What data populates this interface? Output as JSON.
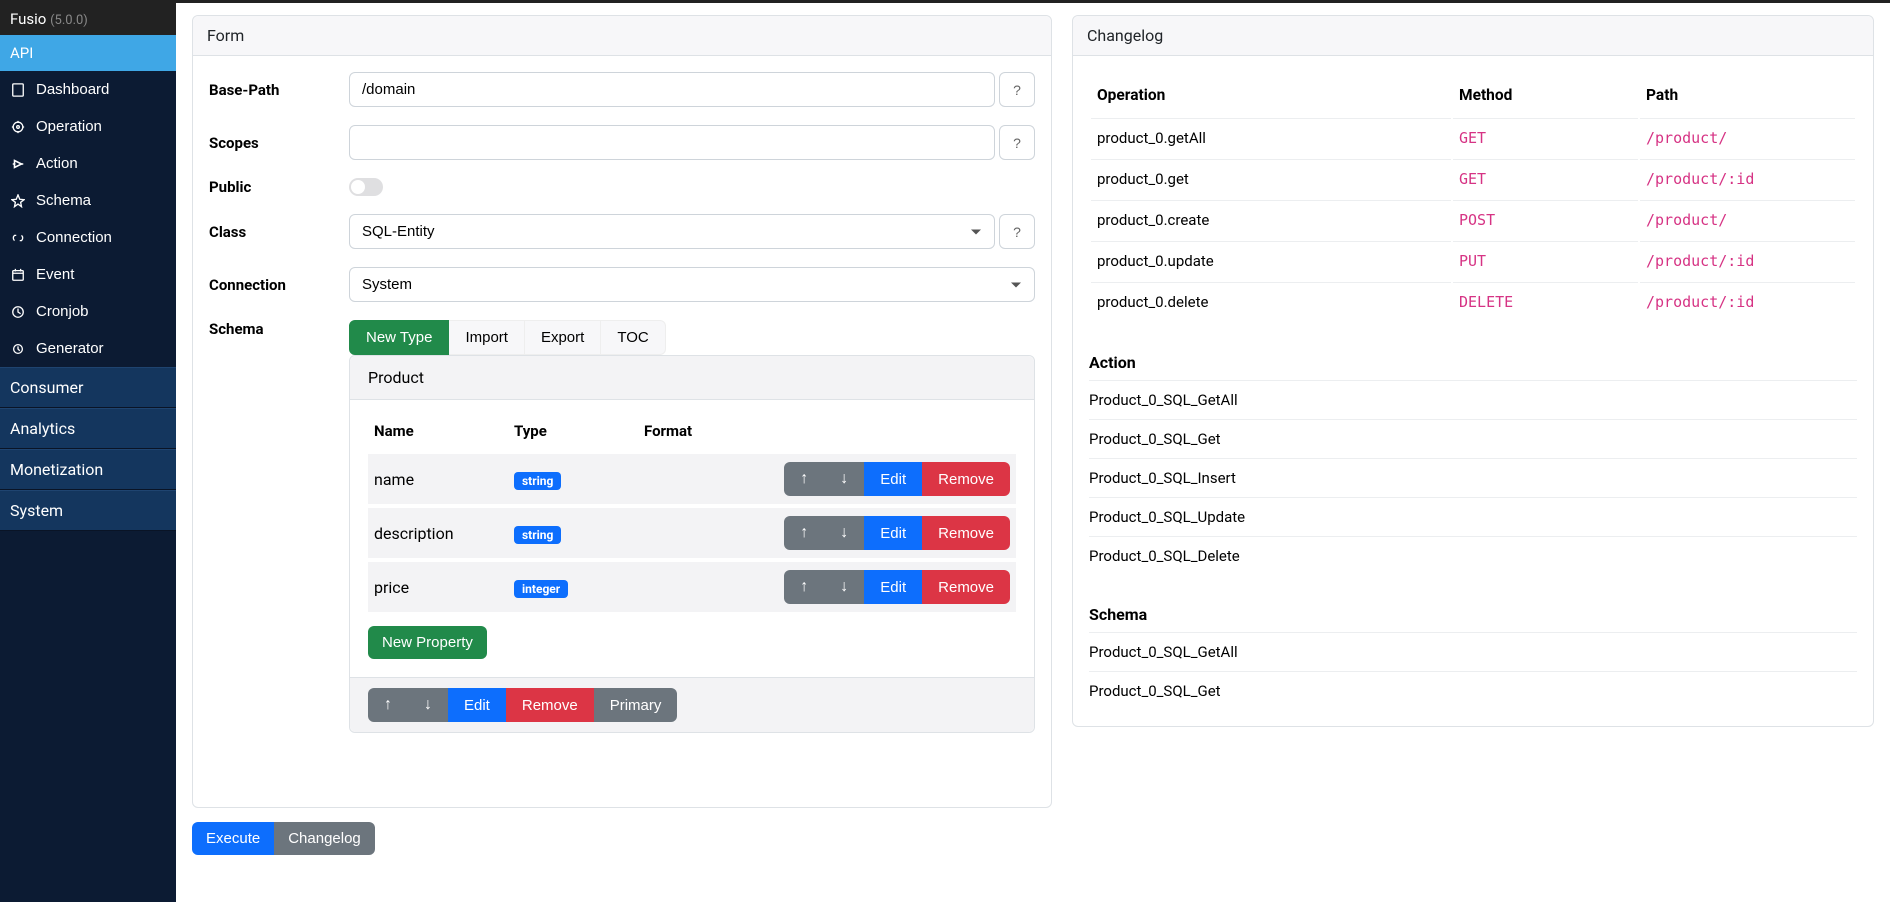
{
  "brand": {
    "name": "Fusio",
    "version": "(5.0.0)"
  },
  "nav": {
    "head": "API",
    "items": [
      {
        "label": "Dashboard",
        "icon": "dashboard-icon"
      },
      {
        "label": "Operation",
        "icon": "operation-icon"
      },
      {
        "label": "Action",
        "icon": "action-icon"
      },
      {
        "label": "Schema",
        "icon": "schema-icon"
      },
      {
        "label": "Connection",
        "icon": "connection-icon"
      },
      {
        "label": "Event",
        "icon": "event-icon"
      },
      {
        "label": "Cronjob",
        "icon": "cronjob-icon"
      },
      {
        "label": "Generator",
        "icon": "generator-icon"
      }
    ],
    "sections": [
      "Consumer",
      "Analytics",
      "Monetization",
      "System"
    ]
  },
  "form": {
    "title": "Form",
    "base_path_label": "Base-Path",
    "base_path_value": "/domain",
    "scopes_label": "Scopes",
    "scopes_value": "",
    "public_label": "Public",
    "class_label": "Class",
    "class_value": "SQL-Entity",
    "connection_label": "Connection",
    "connection_value": "System",
    "schema_label": "Schema",
    "help": "?",
    "tabs": {
      "new_type": "New Type",
      "import": "Import",
      "export": "Export",
      "toc": "TOC"
    },
    "schema_name": "Product",
    "table": {
      "headers": {
        "name": "Name",
        "type": "Type",
        "format": "Format"
      },
      "rows": [
        {
          "name": "name",
          "type": "string"
        },
        {
          "name": "description",
          "type": "string"
        },
        {
          "name": "price",
          "type": "integer"
        }
      ],
      "actions": {
        "up": "↑",
        "down": "↓",
        "edit": "Edit",
        "remove": "Remove"
      }
    },
    "new_property": "New Property",
    "footer": {
      "up": "↑",
      "down": "↓",
      "edit": "Edit",
      "remove": "Remove",
      "primary": "Primary"
    },
    "execute": "Execute",
    "changelog_btn": "Changelog"
  },
  "changelog": {
    "title": "Changelog",
    "headers": {
      "operation": "Operation",
      "method": "Method",
      "path": "Path"
    },
    "ops": [
      {
        "op": "product_0.getAll",
        "method": "GET",
        "path": "/product/"
      },
      {
        "op": "product_0.get",
        "method": "GET",
        "path": "/product/:id"
      },
      {
        "op": "product_0.create",
        "method": "POST",
        "path": "/product/"
      },
      {
        "op": "product_0.update",
        "method": "PUT",
        "path": "/product/:id"
      },
      {
        "op": "product_0.delete",
        "method": "DELETE",
        "path": "/product/:id"
      }
    ],
    "action_label": "Action",
    "actions": [
      "Product_0_SQL_GetAll",
      "Product_0_SQL_Get",
      "Product_0_SQL_Insert",
      "Product_0_SQL_Update",
      "Product_0_SQL_Delete"
    ],
    "schema_label": "Schema",
    "schemas": [
      "Product_0_SQL_GetAll",
      "Product_0_SQL_Get"
    ]
  }
}
